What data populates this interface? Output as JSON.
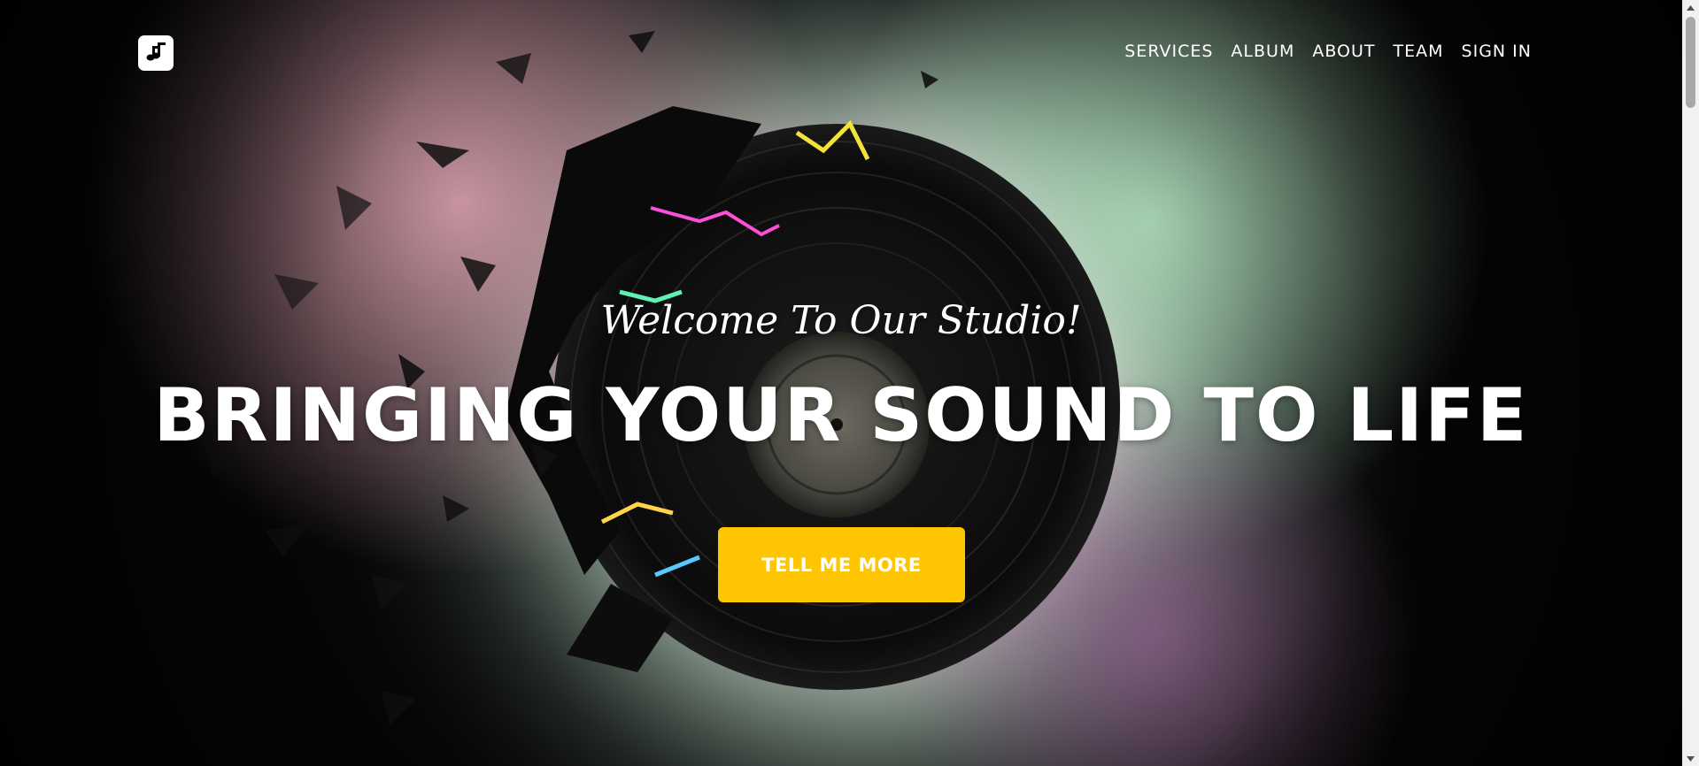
{
  "nav": {
    "logo_icon": "music-note-icon",
    "links": [
      {
        "label": "SERVICES"
      },
      {
        "label": "ALBUM"
      },
      {
        "label": "ABOUT"
      },
      {
        "label": "TEAM"
      },
      {
        "label": "SIGN IN"
      }
    ]
  },
  "hero": {
    "subheading": "Welcome To Our Studio!",
    "heading": "BRINGING YOUR SOUND TO LIFE",
    "button_label": "TELL ME MORE",
    "background_image": "shattering-vinyl-record",
    "colors": {
      "button": "#fec503",
      "text": "#ffffff",
      "background": "#050505"
    }
  },
  "scrollbar": {
    "up_icon": "scroll-up-arrow-icon",
    "down_icon": "scroll-down-arrow-icon"
  }
}
